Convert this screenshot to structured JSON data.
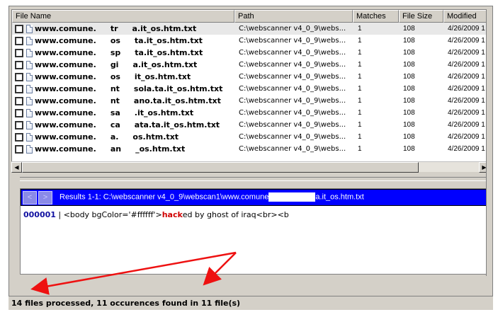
{
  "columns": {
    "name": "File Name",
    "path": "Path",
    "matches": "Matches",
    "size": "File Size",
    "modified": "Modified"
  },
  "rows": [
    {
      "prefix": "www.comune.",
      "part": "tr",
      "suffix": "a.it_os.htm.txt",
      "path": "C:\\webscanner v4_0_9\\webs...",
      "matches": "1",
      "size": "108",
      "modified": "4/26/2009 1"
    },
    {
      "prefix": "www.comune.",
      "part": "os",
      "suffix": "ta.it_os.htm.txt",
      "path": "C:\\webscanner v4_0_9\\webs...",
      "matches": "1",
      "size": "108",
      "modified": "4/26/2009 1"
    },
    {
      "prefix": "www.comune.",
      "part": "sp",
      "suffix": "ta.it_os.htm.txt",
      "path": "C:\\webscanner v4_0_9\\webs...",
      "matches": "1",
      "size": "108",
      "modified": "4/26/2009 1"
    },
    {
      "prefix": "www.comune.",
      "part": "gi",
      "suffix": "a.it_os.htm.txt",
      "path": "C:\\webscanner v4_0_9\\webs...",
      "matches": "1",
      "size": "108",
      "modified": "4/26/2009 1"
    },
    {
      "prefix": "www.comune.",
      "part": "os",
      "suffix": "it_os.htm.txt",
      "path": "C:\\webscanner v4_0_9\\webs...",
      "matches": "1",
      "size": "108",
      "modified": "4/26/2009 1"
    },
    {
      "prefix": "www.comune.",
      "part": "nt",
      "suffix": "sola.ta.it_os.htm.txt",
      "path": "C:\\webscanner v4_0_9\\webs...",
      "matches": "1",
      "size": "108",
      "modified": "4/26/2009 1"
    },
    {
      "prefix": "www.comune.",
      "part": "nt",
      "suffix": "ano.ta.it_os.htm.txt",
      "path": "C:\\webscanner v4_0_9\\webs...",
      "matches": "1",
      "size": "108",
      "modified": "4/26/2009 1"
    },
    {
      "prefix": "www.comune.",
      "part": "sa",
      "suffix": ".it_os.htm.txt",
      "path": "C:\\webscanner v4_0_9\\webs...",
      "matches": "1",
      "size": "108",
      "modified": "4/26/2009 1"
    },
    {
      "prefix": "www.comune.",
      "part": "ca",
      "suffix": "ata.ta.it_os.htm.txt",
      "path": "C:\\webscanner v4_0_9\\webs...",
      "matches": "1",
      "size": "108",
      "modified": "4/26/2009 1"
    },
    {
      "prefix": "www.comune.",
      "part": "a.",
      "suffix": "os.htm.txt",
      "path": "C:\\webscanner v4_0_9\\webs...",
      "matches": "1",
      "size": "108",
      "modified": "4/26/2009 1"
    },
    {
      "prefix": "www.comune.",
      "part": "an",
      "suffix": "_os.htm.txt",
      "path": "C:\\webscanner v4_0_9\\webs...",
      "matches": "1",
      "size": "108",
      "modified": "4/26/2009 1"
    }
  ],
  "scroll": {
    "left_arrow": "◀",
    "right_arrow": "▶"
  },
  "results": {
    "nav_prev": "<",
    "nav_next": ">",
    "title_before": "Results 1-1: C:\\webscanner v4_0_9\\webscan1\\www.comune",
    "title_after": "a.it_os.htm.txt",
    "line_number": "000001",
    "separator": " | ",
    "code_before": "<body bgColor='#ffffff'>",
    "code_match": "hack",
    "code_after": "ed by ghost of iraq<br><b"
  },
  "status": {
    "text": "14 files processed, 11 occurences found in 11 file(s)"
  },
  "colors": {
    "results_bar": "#0000ff",
    "match_highlight": "#d00000",
    "annotation_arrow": "#ee1111"
  },
  "icons": [
    "checkbox-icon",
    "document-icon",
    "arrow-left-icon",
    "arrow-right-icon"
  ]
}
